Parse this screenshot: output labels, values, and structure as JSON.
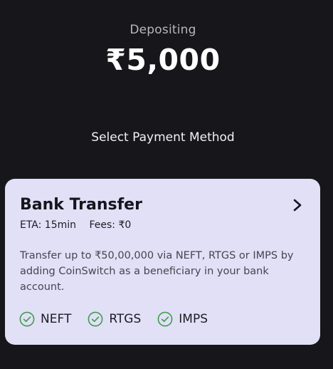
{
  "header": {
    "label": "Depositing",
    "amount": "₹5,000"
  },
  "section_title": "Select Payment Method",
  "payment_methods": [
    {
      "title": "Bank Transfer",
      "eta": "ETA: 15min",
      "fees": "Fees: ₹0",
      "description": "Transfer up to ₹50,00,000 via NEFT, RTGS or IMPS by adding CoinSwitch as a beneficiary in your bank account.",
      "options": [
        "NEFT",
        "RTGS",
        "IMPS"
      ],
      "icons": {
        "navigate": "chevron-right-icon",
        "option": "check-circle-icon"
      }
    }
  ],
  "colors": {
    "background": "#17171b",
    "card": "#e1e0f7",
    "check": "#3f9d4a"
  }
}
